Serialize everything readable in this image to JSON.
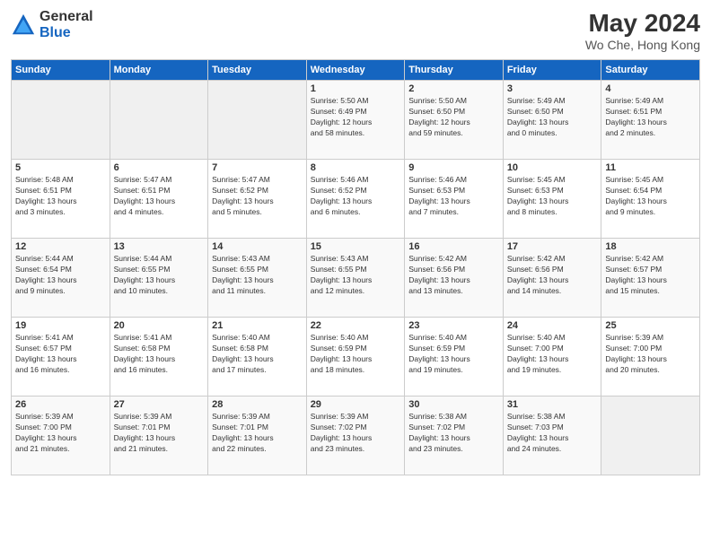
{
  "logo": {
    "general": "General",
    "blue": "Blue"
  },
  "title": "May 2024",
  "location": "Wo Che, Hong Kong",
  "days_of_week": [
    "Sunday",
    "Monday",
    "Tuesday",
    "Wednesday",
    "Thursday",
    "Friday",
    "Saturday"
  ],
  "weeks": [
    [
      {
        "day": "",
        "info": ""
      },
      {
        "day": "",
        "info": ""
      },
      {
        "day": "",
        "info": ""
      },
      {
        "day": "1",
        "info": "Sunrise: 5:50 AM\nSunset: 6:49 PM\nDaylight: 12 hours\nand 58 minutes."
      },
      {
        "day": "2",
        "info": "Sunrise: 5:50 AM\nSunset: 6:50 PM\nDaylight: 12 hours\nand 59 minutes."
      },
      {
        "day": "3",
        "info": "Sunrise: 5:49 AM\nSunset: 6:50 PM\nDaylight: 13 hours\nand 0 minutes."
      },
      {
        "day": "4",
        "info": "Sunrise: 5:49 AM\nSunset: 6:51 PM\nDaylight: 13 hours\nand 2 minutes."
      }
    ],
    [
      {
        "day": "5",
        "info": "Sunrise: 5:48 AM\nSunset: 6:51 PM\nDaylight: 13 hours\nand 3 minutes."
      },
      {
        "day": "6",
        "info": "Sunrise: 5:47 AM\nSunset: 6:51 PM\nDaylight: 13 hours\nand 4 minutes."
      },
      {
        "day": "7",
        "info": "Sunrise: 5:47 AM\nSunset: 6:52 PM\nDaylight: 13 hours\nand 5 minutes."
      },
      {
        "day": "8",
        "info": "Sunrise: 5:46 AM\nSunset: 6:52 PM\nDaylight: 13 hours\nand 6 minutes."
      },
      {
        "day": "9",
        "info": "Sunrise: 5:46 AM\nSunset: 6:53 PM\nDaylight: 13 hours\nand 7 minutes."
      },
      {
        "day": "10",
        "info": "Sunrise: 5:45 AM\nSunset: 6:53 PM\nDaylight: 13 hours\nand 8 minutes."
      },
      {
        "day": "11",
        "info": "Sunrise: 5:45 AM\nSunset: 6:54 PM\nDaylight: 13 hours\nand 9 minutes."
      }
    ],
    [
      {
        "day": "12",
        "info": "Sunrise: 5:44 AM\nSunset: 6:54 PM\nDaylight: 13 hours\nand 9 minutes."
      },
      {
        "day": "13",
        "info": "Sunrise: 5:44 AM\nSunset: 6:55 PM\nDaylight: 13 hours\nand 10 minutes."
      },
      {
        "day": "14",
        "info": "Sunrise: 5:43 AM\nSunset: 6:55 PM\nDaylight: 13 hours\nand 11 minutes."
      },
      {
        "day": "15",
        "info": "Sunrise: 5:43 AM\nSunset: 6:55 PM\nDaylight: 13 hours\nand 12 minutes."
      },
      {
        "day": "16",
        "info": "Sunrise: 5:42 AM\nSunset: 6:56 PM\nDaylight: 13 hours\nand 13 minutes."
      },
      {
        "day": "17",
        "info": "Sunrise: 5:42 AM\nSunset: 6:56 PM\nDaylight: 13 hours\nand 14 minutes."
      },
      {
        "day": "18",
        "info": "Sunrise: 5:42 AM\nSunset: 6:57 PM\nDaylight: 13 hours\nand 15 minutes."
      }
    ],
    [
      {
        "day": "19",
        "info": "Sunrise: 5:41 AM\nSunset: 6:57 PM\nDaylight: 13 hours\nand 16 minutes."
      },
      {
        "day": "20",
        "info": "Sunrise: 5:41 AM\nSunset: 6:58 PM\nDaylight: 13 hours\nand 16 minutes."
      },
      {
        "day": "21",
        "info": "Sunrise: 5:40 AM\nSunset: 6:58 PM\nDaylight: 13 hours\nand 17 minutes."
      },
      {
        "day": "22",
        "info": "Sunrise: 5:40 AM\nSunset: 6:59 PM\nDaylight: 13 hours\nand 18 minutes."
      },
      {
        "day": "23",
        "info": "Sunrise: 5:40 AM\nSunset: 6:59 PM\nDaylight: 13 hours\nand 19 minutes."
      },
      {
        "day": "24",
        "info": "Sunrise: 5:40 AM\nSunset: 7:00 PM\nDaylight: 13 hours\nand 19 minutes."
      },
      {
        "day": "25",
        "info": "Sunrise: 5:39 AM\nSunset: 7:00 PM\nDaylight: 13 hours\nand 20 minutes."
      }
    ],
    [
      {
        "day": "26",
        "info": "Sunrise: 5:39 AM\nSunset: 7:00 PM\nDaylight: 13 hours\nand 21 minutes."
      },
      {
        "day": "27",
        "info": "Sunrise: 5:39 AM\nSunset: 7:01 PM\nDaylight: 13 hours\nand 21 minutes."
      },
      {
        "day": "28",
        "info": "Sunrise: 5:39 AM\nSunset: 7:01 PM\nDaylight: 13 hours\nand 22 minutes."
      },
      {
        "day": "29",
        "info": "Sunrise: 5:39 AM\nSunset: 7:02 PM\nDaylight: 13 hours\nand 23 minutes."
      },
      {
        "day": "30",
        "info": "Sunrise: 5:38 AM\nSunset: 7:02 PM\nDaylight: 13 hours\nand 23 minutes."
      },
      {
        "day": "31",
        "info": "Sunrise: 5:38 AM\nSunset: 7:03 PM\nDaylight: 13 hours\nand 24 minutes."
      },
      {
        "day": "",
        "info": ""
      }
    ]
  ]
}
